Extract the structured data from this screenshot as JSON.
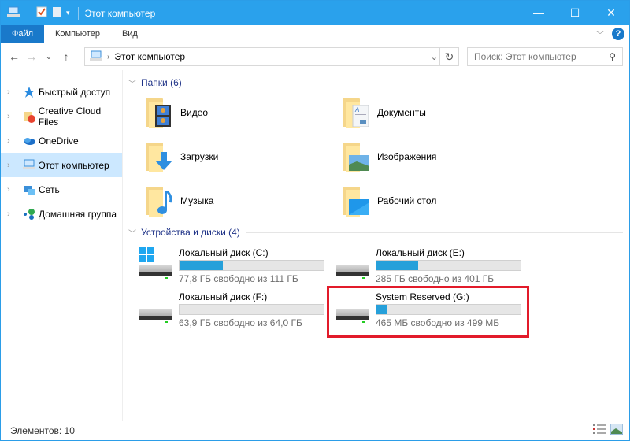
{
  "window": {
    "title": "Этот компьютер",
    "minimize_glyph": "—",
    "maximize_glyph": "☐",
    "close_glyph": "✕"
  },
  "ribbon": {
    "tabs": [
      {
        "label": "Файл",
        "active": true
      },
      {
        "label": "Компьютер"
      },
      {
        "label": "Вид"
      }
    ]
  },
  "navigation": {
    "back": "←",
    "forward": "→",
    "recent": "⌄",
    "up": "↑",
    "address_path": "Этот компьютер",
    "search_placeholder": "Поиск: Этот компьютер"
  },
  "sidebar": {
    "items": [
      {
        "label": "Быстрый доступ",
        "icon": "star-icon"
      },
      {
        "label": "Creative Cloud Files",
        "icon": "creative-cloud-icon"
      },
      {
        "label": "OneDrive",
        "icon": "onedrive-icon"
      },
      {
        "label": "Этот компьютер",
        "icon": "computer-icon",
        "selected": true
      },
      {
        "label": "Сеть",
        "icon": "network-icon"
      },
      {
        "label": "Домашняя группа",
        "icon": "homegroup-icon"
      }
    ]
  },
  "folders_group": {
    "title": "Папки (6)",
    "items": [
      {
        "label": "Видео",
        "icon": "video-folder-icon"
      },
      {
        "label": "Документы",
        "icon": "documents-folder-icon"
      },
      {
        "label": "Загрузки",
        "icon": "downloads-folder-icon"
      },
      {
        "label": "Изображения",
        "icon": "pictures-folder-icon"
      },
      {
        "label": "Музыка",
        "icon": "music-folder-icon"
      },
      {
        "label": "Рабочий стол",
        "icon": "desktop-folder-icon"
      }
    ]
  },
  "drives_group": {
    "title": "Устройства и диски (4)",
    "items": [
      {
        "label": "Локальный диск (C:)",
        "free_text": "77,8 ГБ свободно из 111 ГБ",
        "used_fraction": 0.3,
        "windows": true
      },
      {
        "label": "Локальный диск (E:)",
        "free_text": "285 ГБ свободно из 401 ГБ",
        "used_fraction": 0.29
      },
      {
        "label": "Локальный диск (F:)",
        "free_text": "63,9 ГБ свободно из 64,0 ГБ",
        "used_fraction": 0.002
      },
      {
        "label": "System Reserved (G:)",
        "free_text": "465 МБ свободно из 499 МБ",
        "used_fraction": 0.07,
        "highlighted": true
      }
    ]
  },
  "accent_colors": {
    "titlebar": "#2aa1ec",
    "file_tab": "#1979ca",
    "bar_fill": "#26a0da",
    "highlight_box": "#e21b2a"
  },
  "status": {
    "items_count": "Элементов: 10"
  }
}
